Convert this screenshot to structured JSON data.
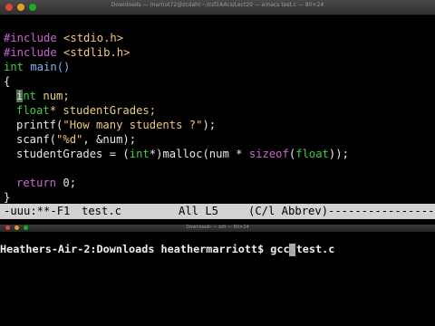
{
  "top_window": {
    "title": "Downloads — marriot72@zcdahl:~/csf2AAcs/Lect20 — emacs test.c — 80×24"
  },
  "code": {
    "line1": {
      "directive": "#include",
      "rest": " <stdio.h>"
    },
    "line2": {
      "directive": "#include",
      "rest": " <stdlib.h>"
    },
    "line3": {
      "type": "int",
      "rest": " main()"
    },
    "line4": "{",
    "line5": {
      "cursor_char": "i",
      "type_rest": "nt",
      "rest": " num;"
    },
    "line6": {
      "type": "float",
      "rest": "* studentGrades;"
    },
    "line7": {
      "before": "printf(",
      "string": "\"How many students ?\"",
      "after": ");"
    },
    "line8": {
      "before": "scanf(",
      "string": "\"%d\"",
      "after": ", &num);"
    },
    "line9": {
      "before": "studentGrades = (",
      "cast": "int",
      "mid": "*)malloc(num * ",
      "sizeof": "sizeof",
      "paren_open": "(",
      "type": "float",
      "after": "));"
    },
    "line11": {
      "keyword": "return",
      "rest": " 0;"
    },
    "line12": "}"
  },
  "modeline": {
    "status": "-uuu:**-F1",
    "filename": "test.c",
    "position": "All L5",
    "mode": "(C/l Abbrev)",
    "fill": "-------------------"
  },
  "bottom_window": {
    "title": "Downloads — zsh — 80×24"
  },
  "terminal": {
    "prompt": "Heathers-Air-2:Downloads heathermarriott$ gcc test.c"
  }
}
